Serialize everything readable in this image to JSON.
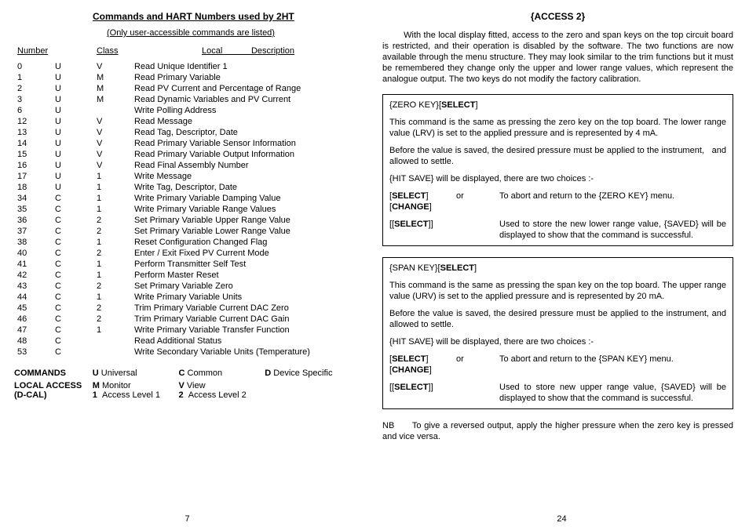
{
  "left": {
    "title": "Commands and HART Numbers used by 2HT",
    "subtitle": "(Only user-accessible commands are listed)",
    "headers": {
      "number": "Number",
      "class": "Class",
      "local": "Local",
      "description": "Description"
    },
    "rows": [
      {
        "n": "0",
        "uc": "U",
        "cls": "V",
        "d": "Read Unique Identifier 1"
      },
      {
        "n": "1",
        "uc": "U",
        "cls": "M",
        "d": "Read Primary Variable"
      },
      {
        "n": "2",
        "uc": "U",
        "cls": "M",
        "d": "Read PV Current and Percentage of Range"
      },
      {
        "n": "3",
        "uc": "U",
        "cls": "M",
        "d": "Read Dynamic Variables and PV Current"
      },
      {
        "n": "6",
        "uc": "U",
        "cls": "",
        "d": "Write Polling Address"
      },
      {
        "n": "12",
        "uc": "U",
        "cls": "V",
        "d": "Read Message"
      },
      {
        "n": "13",
        "uc": "U",
        "cls": "V",
        "d": "Read Tag, Descriptor, Date"
      },
      {
        "n": "14",
        "uc": "U",
        "cls": "V",
        "d": "Read Primary Variable Sensor Information"
      },
      {
        "n": "15",
        "uc": "U",
        "cls": "V",
        "d": "Read Primary Variable Output Information"
      },
      {
        "n": "16",
        "uc": "U",
        "cls": "V",
        "d": "Read Final Assembly Number"
      },
      {
        "n": "17",
        "uc": "U",
        "cls": "1",
        "d": "Write Message"
      },
      {
        "n": "18",
        "uc": "U",
        "cls": "1",
        "d": "Write Tag, Descriptor, Date"
      },
      {
        "n": "34",
        "uc": "C",
        "cls": "1",
        "d": "Write Primary Variable Damping Value"
      },
      {
        "n": "35",
        "uc": "C",
        "cls": "1",
        "d": "Write Primary Variable Range Values"
      },
      {
        "n": "36",
        "uc": "C",
        "cls": "2",
        "d": "Set Primary Variable Upper Range Value"
      },
      {
        "n": "37",
        "uc": "C",
        "cls": "2",
        "d": "Set Primary Variable Lower Range Value"
      },
      {
        "n": "38",
        "uc": "C",
        "cls": "1",
        "d": "Reset Configuration Changed Flag"
      },
      {
        "n": "40",
        "uc": "C",
        "cls": "2",
        "d": "Enter / Exit Fixed PV Current Mode"
      },
      {
        "n": "41",
        "uc": "C",
        "cls": "1",
        "d": "Perform Transmitter Self Test"
      },
      {
        "n": "42",
        "uc": "C",
        "cls": "1",
        "d": "Perform Master Reset"
      },
      {
        "n": "43",
        "uc": "C",
        "cls": "2",
        "d": "Set Primary Variable Zero"
      },
      {
        "n": "44",
        "uc": "C",
        "cls": "1",
        "d": "Write Primary Variable Units"
      },
      {
        "n": "45",
        "uc": "C",
        "cls": "2",
        "d": "Trim Primary Variable Current DAC Zero"
      },
      {
        "n": "46",
        "uc": "C",
        "cls": "2",
        "d": "Trim Primary Variable Current DAC Gain"
      },
      {
        "n": "47",
        "uc": "C",
        "cls": "1",
        "d": "Write Primary Variable Transfer Function"
      },
      {
        "n": "48",
        "uc": "C",
        "cls": "",
        "d": "Read Additional Status"
      },
      {
        "n": "53",
        "uc": "C",
        "cls": "",
        "d": "Write Secondary Variable Units (Temperature)"
      }
    ],
    "legend": {
      "commands_label": "COMMANDS",
      "u_key": "U",
      "u_val": "Universal",
      "c_key": "C",
      "c_val": "Common",
      "d_key": "D",
      "d_val": "Device Specific",
      "local_label": "LOCAL ACCESS",
      "local_label2": "(D-CAL)",
      "m_key": "M",
      "m_val": "Monitor",
      "v_key": "V",
      "v_val": "View",
      "l1_key": "1",
      "l1_val": "Access Level 1",
      "l2_key": "2",
      "l2_val": "Access Level 2"
    },
    "page": "7"
  },
  "right": {
    "title": "{ACCESS 2}",
    "intro": "With the local display fitted, access to the zero and span keys on the top circuit board is restricted, and their operation is disabled by the software. The two functions are now available through the menu structure. They may look similar to the trim functions but it must be remembered they change only the upper and lower range values, which represent the analogue output. The two keys do not modify the factory calibration.",
    "zero": {
      "head_pre": "{ZERO KEY}[",
      "head_bold": "SELECT",
      "head_post": "]",
      "p1": "This command is the same as pressing the zero key on the top board. The lower range value (LRV) is set to the applied pressure and is represented by 4 mA.",
      "p2a": "Before the value is saved, the desired pressure must be applied to the instrument,",
      "p2b": "and allowed to settle.",
      "p3": "{HIT SAVE} will be displayed, there are two choices :-",
      "opt1_l1a": "[",
      "opt1_l1b": "SELECT",
      "opt1_l1c": "]",
      "opt1_l2a": "[",
      "opt1_l2b": "CHANGE",
      "opt1_l2c": "]",
      "opt1_mid": "or",
      "opt1_r": "To abort and return to the {ZERO KEY} menu.",
      "opt2_l_a": "[[",
      "opt2_l_b": "SELECT",
      "opt2_l_c": "]]",
      "opt2_r": "Used to store the new lower range value, {SAVED} will be displayed to show that the command is successful."
    },
    "span": {
      "head_pre": "{SPAN KEY}[",
      "head_bold": "SELECT",
      "head_post": "]",
      "p1": "This command is the same as pressing the span key on the top board. The upper range value (URV) is set to the applied pressure and is represented by 20 mA.",
      "p2": "Before the value is saved, the desired pressure must be applied to the instrument, and allowed to settle.",
      "p3": "{HIT SAVE} will be displayed, there are two choices :-",
      "opt1_l1a": "[",
      "opt1_l1b": "SELECT",
      "opt1_l1c": "]",
      "opt1_l2a": "[",
      "opt1_l2b": "CHANGE",
      "opt1_l2c": "]",
      "opt1_mid": "or",
      "opt1_r": "To abort and return to the {SPAN KEY} menu.",
      "opt2_l_a": "[[",
      "opt2_l_b": "SELECT",
      "opt2_l_c": "]]",
      "opt2_r": "Used to store new upper range value, {SAVED} will be displayed to show that the command is successful."
    },
    "nb_pre": "NB",
    "nb": "To give a reversed output, apply the higher pressure when the zero key is pressed and vice versa.",
    "page": "24"
  }
}
